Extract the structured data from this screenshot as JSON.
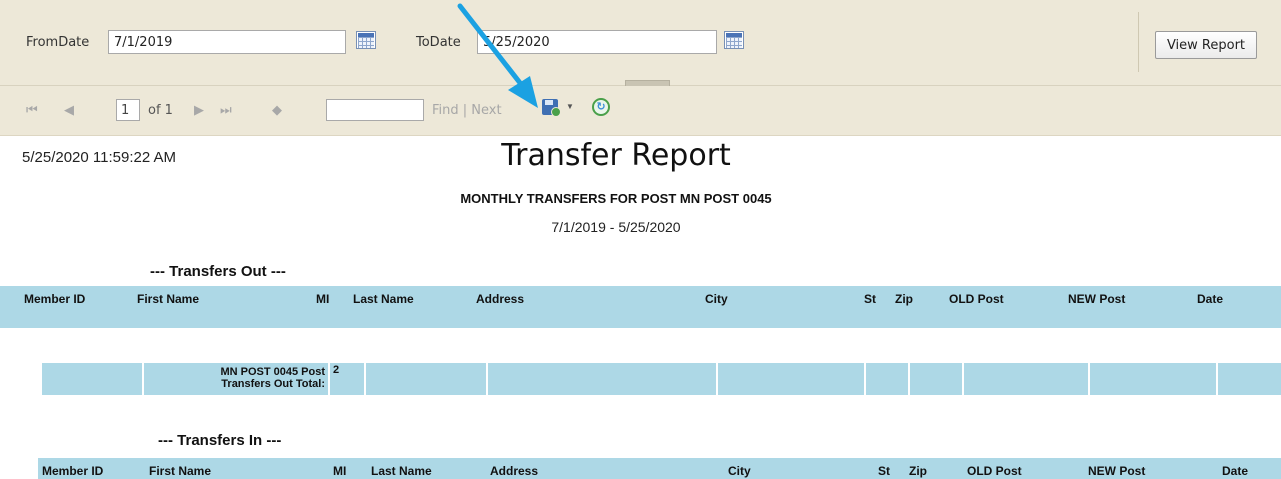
{
  "params": {
    "from_label": "FromDate",
    "from_value": "7/1/2019",
    "to_label": "ToDate",
    "to_value": "5/25/2020",
    "view_report_label": "View Report"
  },
  "toolbar": {
    "page_value": "1",
    "of_text": "of 1",
    "find_value": "",
    "find_next_text": "Find | Next",
    "icons": [
      "first-page-icon",
      "prev-page-icon",
      "next-page-icon",
      "last-page-icon",
      "back-icon",
      "save-export-icon",
      "dropdown-arrow-icon",
      "refresh-icon"
    ]
  },
  "report": {
    "timestamp": "5/25/2020 11:59:22 AM",
    "title": "Transfer Report",
    "subtitle": "MONTHLY TRANSFERS FOR POST MN POST 0045",
    "date_range": "7/1/2019 - 5/25/2020",
    "transfers_out": {
      "heading": "--- Transfers Out ---",
      "columns": [
        "Member ID",
        "First Name",
        "MI",
        "Last Name",
        "Address",
        "City",
        "St",
        "Zip",
        "OLD Post",
        "NEW Post",
        "Date"
      ],
      "total_label_line1": "MN POST 0045 Post",
      "total_label_line2": "Transfers Out Total:",
      "total_value": "2"
    },
    "transfers_in": {
      "heading": "--- Transfers In ---",
      "columns": [
        "Member ID",
        "First Name",
        "MI",
        "Last Name",
        "Address",
        "City",
        "St",
        "Zip",
        "OLD Post",
        "NEW Post",
        "Date"
      ]
    }
  },
  "colors": {
    "toolbar_bg": "#ede8d8",
    "table_header": "#add8e6",
    "annotation_arrow": "#1ba1e2"
  }
}
